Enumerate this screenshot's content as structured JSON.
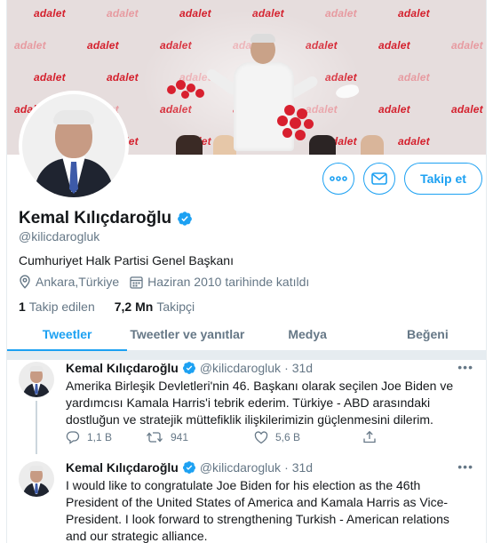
{
  "banner": {
    "watermark": "adalet"
  },
  "profile": {
    "name": "Kemal Kılıçdaroğlu",
    "handle": "@kilicdarogluk",
    "bio": "Cumhuriyet Halk Partisi Genel Başkanı",
    "location": "Ankara,Türkiye",
    "joined": "Haziran 2010 tarihinde katıldı",
    "following_count": "1",
    "following_label": "Takip edilen",
    "followers_count": "7,2 Mn",
    "followers_label": "Takipçi",
    "follow_button": "Takip et",
    "more_icon": "more-icon",
    "message_icon": "envelope-icon",
    "accent_color": "#1da1f2"
  },
  "tabs": [
    {
      "label": "Tweetler",
      "active": true
    },
    {
      "label": "Tweetler ve yanıtlar",
      "active": false
    },
    {
      "label": "Medya",
      "active": false
    },
    {
      "label": "Beğeni",
      "active": false
    }
  ],
  "tweets": [
    {
      "name": "Kemal Kılıçdaroğlu",
      "handle": "@kilicdarogluk",
      "sep": "·",
      "time": "31d",
      "text": "Amerika Birleşik Devletleri'nin 46. Başkanı olarak seçilen Joe Biden ve yardımcısı Kamala Harris'i tebrik ederim. Türkiye - ABD arasındaki dostluğun ve stratejik müttefiklik ilişkilerimizin güçlenmesini dilerim.",
      "replies": "1,1 B",
      "retweets": "941",
      "likes": "5,6 B"
    },
    {
      "name": "Kemal Kılıçdaroğlu",
      "handle": "@kilicdarogluk",
      "sep": "·",
      "time": "31d",
      "text": "I would like to congratulate Joe Biden for his election as the 46th President of the United States of America and Kamala Harris as Vice-President. I look forward to strengthening Turkish - American relations and our strategic alliance."
    }
  ]
}
